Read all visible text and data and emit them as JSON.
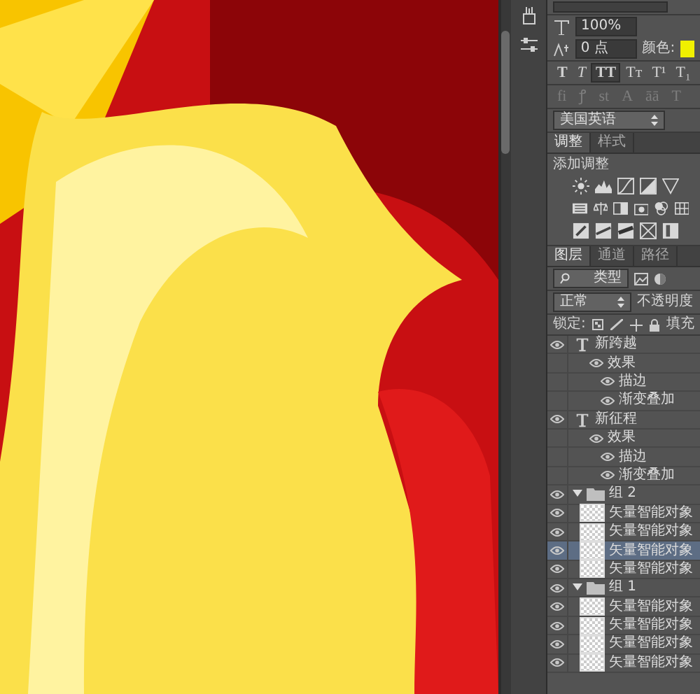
{
  "character": {
    "scale": "100%",
    "baseline_shift": "0 点",
    "color_label": "颜色:",
    "color": "#f0f000",
    "language": "美国英语"
  },
  "style_buttons": [
    {
      "kind": "bold",
      "label": "T",
      "selected": false
    },
    {
      "kind": "italic",
      "label": "T",
      "selected": false
    },
    {
      "kind": "caps",
      "label": "TT",
      "selected": true
    },
    {
      "kind": "smallcaps",
      "label": "Tт",
      "selected": false
    },
    {
      "kind": "super",
      "label": "T¹",
      "selected": false
    },
    {
      "kind": "sub",
      "label": "T₁",
      "selected": false
    }
  ],
  "opentype_buttons": [
    "fi",
    "ꝭ",
    "st",
    "A",
    "āā",
    "T"
  ],
  "adjust_tabs": [
    {
      "label": "调整",
      "selected": true
    },
    {
      "label": "样式",
      "selected": false
    }
  ],
  "adjust_heading": "添加调整",
  "layer_tabs": [
    {
      "label": "图层",
      "selected": true
    },
    {
      "label": "通道",
      "selected": false
    },
    {
      "label": "路径",
      "selected": false
    }
  ],
  "filter": "类型",
  "blend_mode": "正常",
  "opacity_label": "不透明度",
  "lock_label": "锁定:",
  "fill_label": "填充",
  "layers": [
    {
      "kind": "text",
      "name": "新跨越",
      "visible": true,
      "selected": false,
      "children": [
        {
          "kind": "effects",
          "name": "效果",
          "visible": true,
          "children": [
            {
              "kind": "effect",
              "name": "描边",
              "visible": true
            },
            {
              "kind": "effect",
              "name": "渐变叠加",
              "visible": true
            }
          ]
        }
      ]
    },
    {
      "kind": "text",
      "name": "新征程",
      "visible": true,
      "selected": false,
      "children": [
        {
          "kind": "effects",
          "name": "效果",
          "visible": true,
          "children": [
            {
              "kind": "effect",
              "name": "描边",
              "visible": true
            },
            {
              "kind": "effect",
              "name": "渐变叠加",
              "visible": true
            }
          ]
        }
      ]
    },
    {
      "kind": "group",
      "name": "组 2",
      "visible": true,
      "selected": false,
      "expanded": true,
      "children": [
        {
          "kind": "smart",
          "name": "矢量智能对象",
          "visible": true,
          "selected": false
        },
        {
          "kind": "smart",
          "name": "矢量智能对象",
          "visible": true,
          "selected": false
        },
        {
          "kind": "smart",
          "name": "矢量智能对象",
          "visible": true,
          "selected": true
        },
        {
          "kind": "smart",
          "name": "矢量智能对象",
          "visible": true,
          "selected": false
        }
      ]
    },
    {
      "kind": "group",
      "name": "组 1",
      "visible": true,
      "selected": false,
      "expanded": true,
      "children": [
        {
          "kind": "smart",
          "name": "矢量智能对象",
          "visible": true,
          "selected": false
        },
        {
          "kind": "smart",
          "name": "矢量智能对象",
          "visible": true,
          "selected": false
        },
        {
          "kind": "smart",
          "name": "矢量智能对象",
          "visible": true,
          "selected": false
        },
        {
          "kind": "smart",
          "name": "矢量智能对象",
          "visible": true,
          "selected": false
        }
      ]
    }
  ]
}
